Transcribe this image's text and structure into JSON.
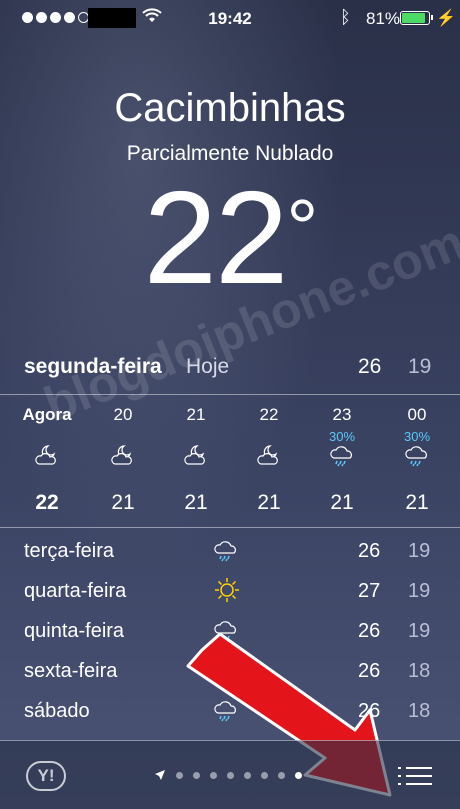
{
  "status": {
    "time": "19:42",
    "battery": "81%",
    "battery_level": 0.81,
    "battery_color": "#4cd964"
  },
  "location": {
    "city": "Cacimbinhas",
    "condition": "Parcialmente Nublado",
    "temperature": "22",
    "degree_symbol": "°"
  },
  "today": {
    "day": "segunda-feira",
    "label": "Hoje",
    "high": "26",
    "low": "19"
  },
  "hourly": [
    {
      "hour": "Agora",
      "precip": "",
      "icon": "partly-cloudy-night-icon",
      "temp": "22"
    },
    {
      "hour": "20",
      "precip": "",
      "icon": "partly-cloudy-night-icon",
      "temp": "21"
    },
    {
      "hour": "21",
      "precip": "",
      "icon": "partly-cloudy-night-icon",
      "temp": "21"
    },
    {
      "hour": "22",
      "precip": "",
      "icon": "partly-cloudy-night-icon",
      "temp": "21"
    },
    {
      "hour": "23",
      "precip": "30%",
      "icon": "rain-cloud-icon",
      "temp": "21"
    },
    {
      "hour": "00",
      "precip": "30%",
      "icon": "rain-cloud-icon",
      "temp": "21"
    }
  ],
  "daily": [
    {
      "day": "terça-feira",
      "icon": "rain-cloud-icon",
      "high": "26",
      "low": "19"
    },
    {
      "day": "quarta-feira",
      "icon": "sun-icon",
      "high": "27",
      "low": "19"
    },
    {
      "day": "quinta-feira",
      "icon": "rain-cloud-icon",
      "high": "26",
      "low": "19"
    },
    {
      "day": "sexta-feira",
      "icon": "rain-cloud-icon",
      "high": "26",
      "low": "18"
    },
    {
      "day": "sábado",
      "icon": "rain-cloud-icon",
      "high": "26",
      "low": "18"
    }
  ],
  "watermark": "blogdoiphone.com",
  "toolbar": {
    "yahoo_logo": "Y!",
    "page_count": 8,
    "active_page": 8
  },
  "colors": {
    "precip": "#5ac8fa",
    "sun": "#ffd200",
    "arrow": "#e3151b"
  }
}
